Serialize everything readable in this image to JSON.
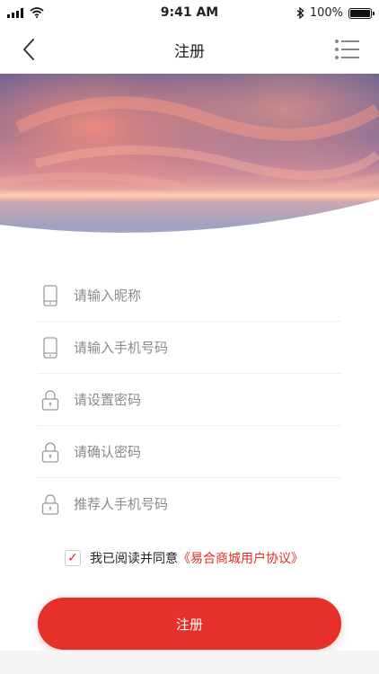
{
  "status_bar": {
    "time": "9:41 AM",
    "battery": "100%"
  },
  "nav": {
    "title": "注册"
  },
  "form": {
    "nickname_placeholder": "请输入昵称",
    "phone_placeholder": "请输入手机号码",
    "password_placeholder": "请设置密码",
    "confirm_password_placeholder": "请确认密码",
    "referrer_placeholder": "推荐人手机号码"
  },
  "agreement": {
    "checked": true,
    "check_mark": "✓",
    "text": "我已阅读并同意",
    "link": "《易合商城用户协议》"
  },
  "register_button": "注册",
  "colors": {
    "accent": "#e6302a",
    "link": "#e22d25"
  },
  "icons": [
    "back-arrow-icon",
    "list-menu-icon",
    "phone-icon",
    "lock-icon",
    "signal-icon",
    "wifi-icon",
    "bluetooth-icon",
    "battery-icon"
  ]
}
